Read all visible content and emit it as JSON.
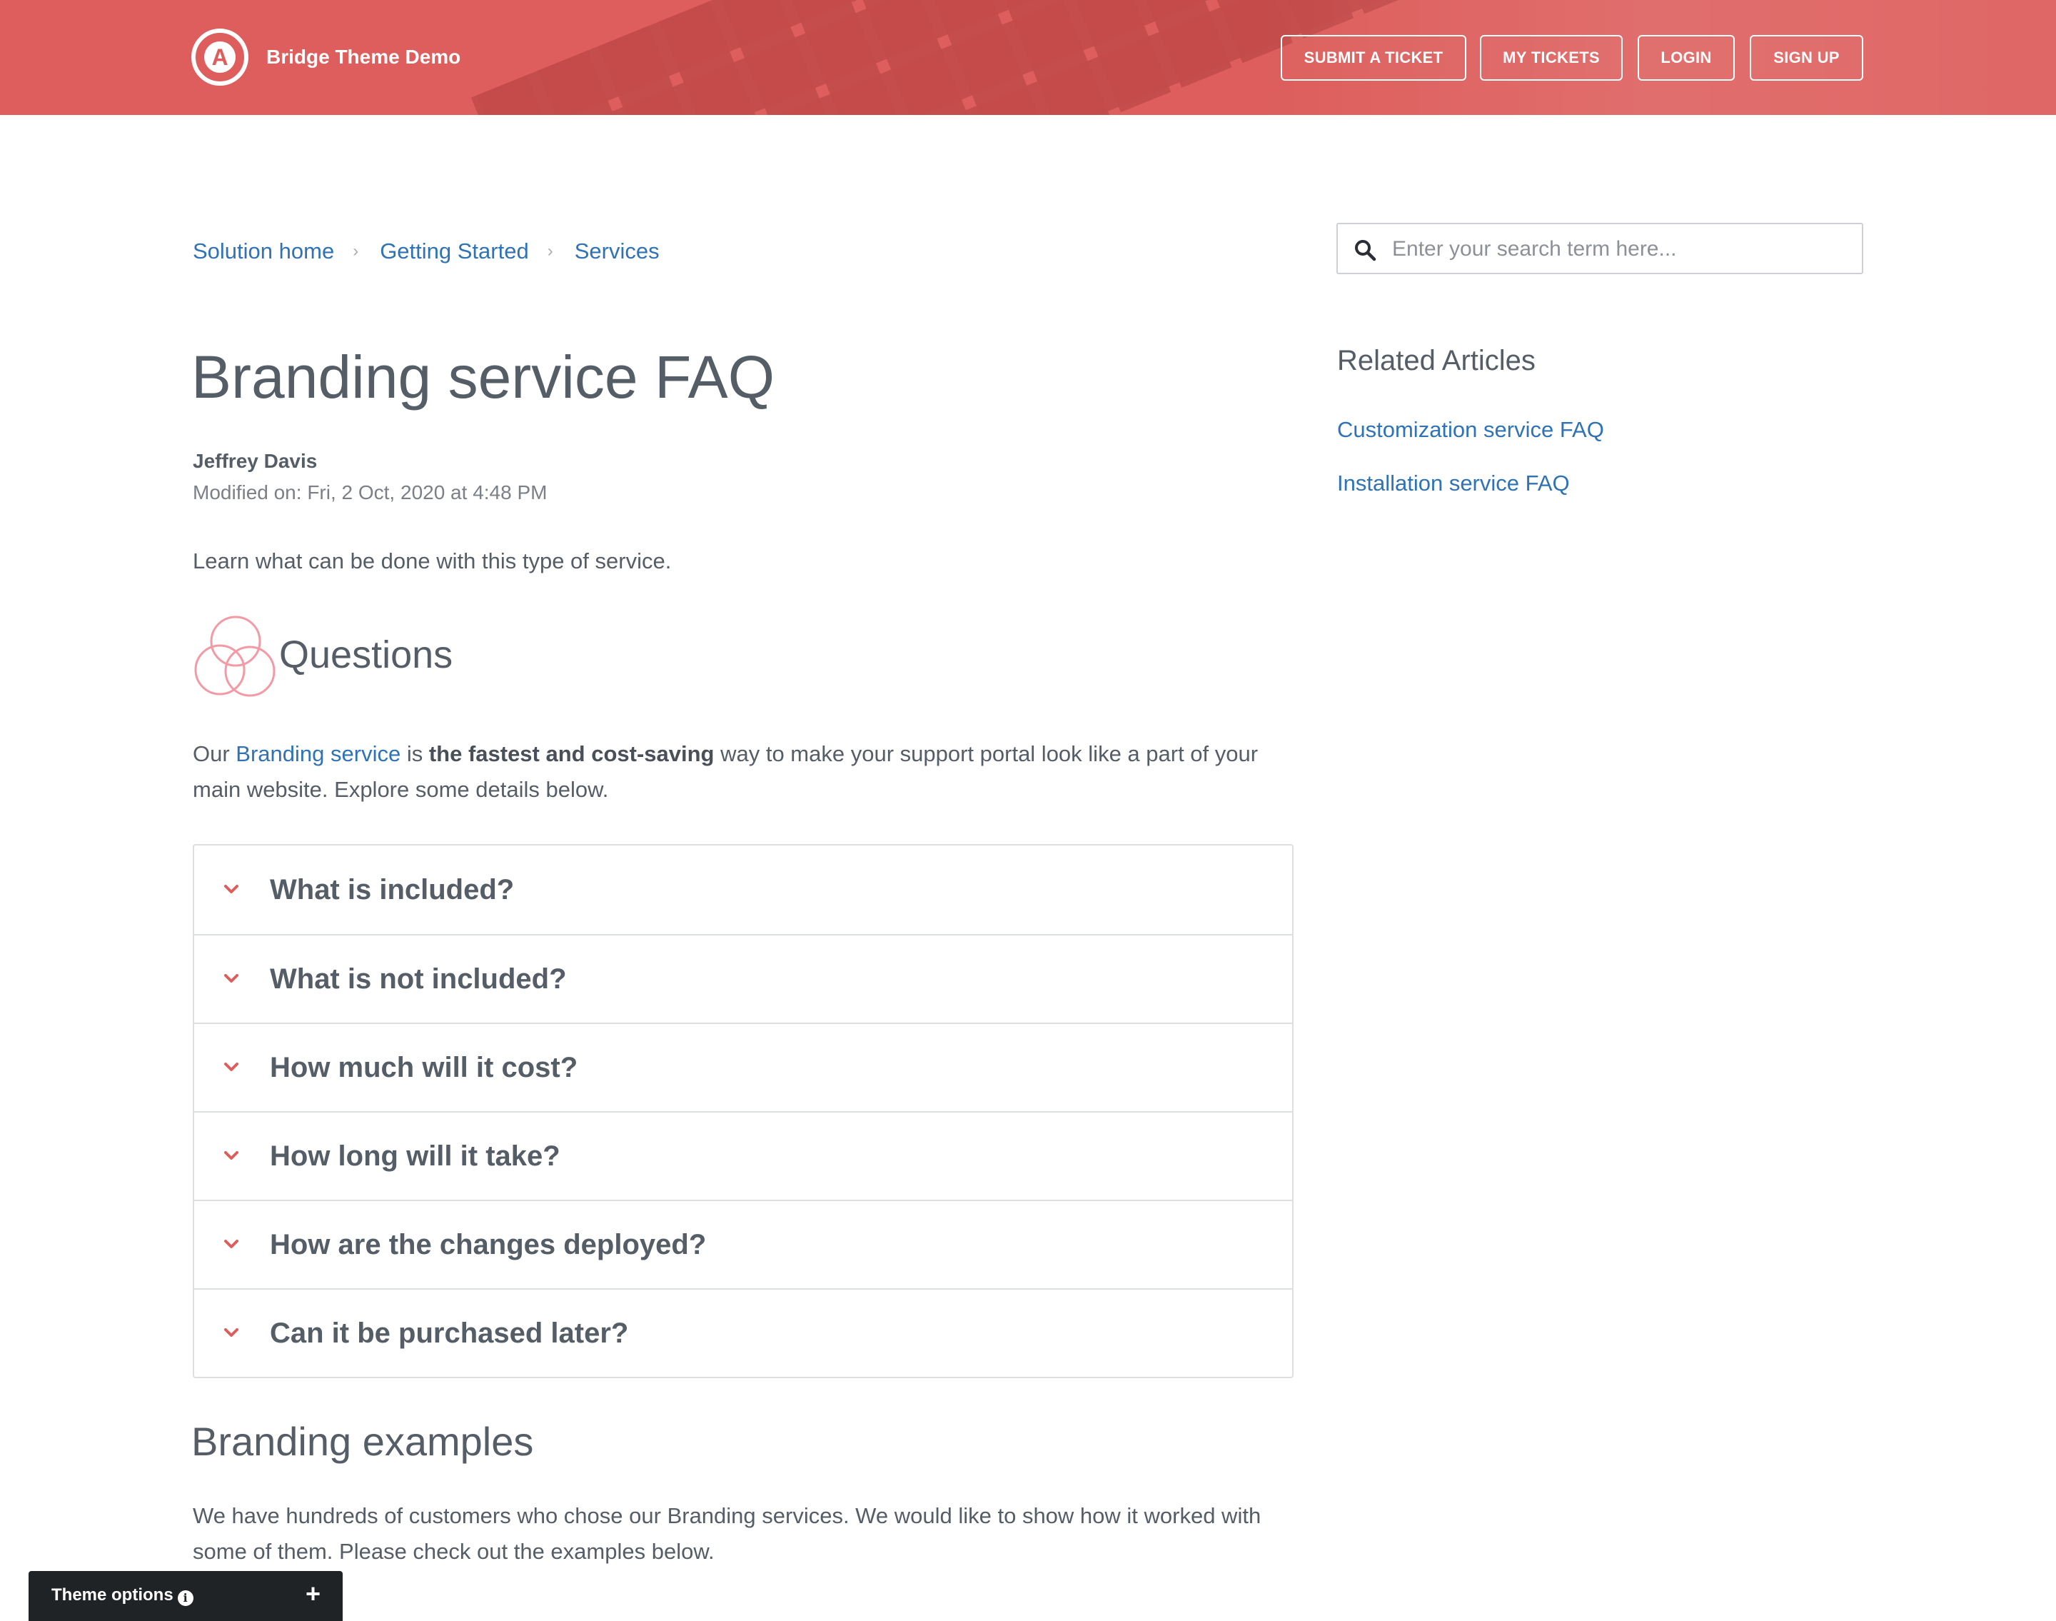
{
  "header": {
    "brand": "Bridge Theme Demo",
    "logo_letter": "A",
    "nav": {
      "submit_ticket": "SUBMIT A TICKET",
      "my_tickets": "MY TICKETS",
      "login": "LOGIN",
      "sign_up": "SIGN UP"
    },
    "colors": {
      "header_bg": "#dd5e5c"
    }
  },
  "breadcrumb": {
    "items": [
      "Solution home",
      "Getting Started",
      "Services"
    ],
    "separator": "›"
  },
  "search": {
    "placeholder": "Enter your search term here..."
  },
  "article": {
    "title": "Branding service FAQ",
    "author": "Jeffrey Davis",
    "modified": "Modified on: Fri, 2 Oct, 2020 at 4:48 PM",
    "lead": "Learn what can be done with this type of service.",
    "questions_heading": "Questions",
    "intro": {
      "part1": "Our ",
      "link": "Branding service",
      "part2": " is ",
      "bold": "the fastest and cost-saving",
      "part3": " way to make your support portal look like a part of your main website. Explore some details below."
    },
    "faq": [
      "What is included?",
      "What is not included?",
      "How much will it cost?",
      "How long will it take?",
      "How are the changes deployed?",
      "Can it be purchased later?"
    ],
    "examples_heading": "Branding examples",
    "examples_text": "We have hundreds of customers who chose our Branding services. We would like to show how it worked with some of them. Please check out the examples below."
  },
  "related": {
    "title": "Related Articles",
    "links": [
      "Customization service FAQ",
      "Installation service FAQ"
    ]
  },
  "theme_options": {
    "label": "Theme options",
    "info_icon": "i",
    "expand_icon": "+"
  },
  "colors": {
    "link": "#2f73b6",
    "accent": "#dd5e5c",
    "text": "#555d67"
  }
}
